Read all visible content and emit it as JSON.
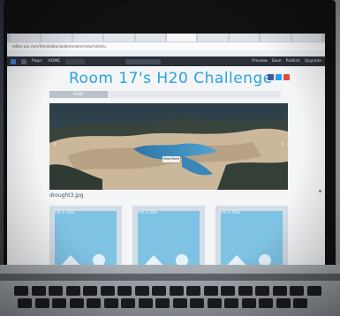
{
  "browser": {
    "tabs": [
      "",
      "",
      "",
      "",
      "",
      "",
      "",
      "",
      "",
      ""
    ],
    "url": "editor.wix.com/html/editor/web/renderer/new?siteId=",
    "bookmarks": ""
  },
  "editor": {
    "page_label": "Page:",
    "page_value": "HOME",
    "actions": [
      "Preview",
      "Save",
      "Publish",
      "Upgrade"
    ]
  },
  "site": {
    "title": "Room 17's H20 Challenge",
    "nav": [
      "HOME",
      "",
      "",
      ""
    ],
    "caption": "drought3.jpg",
    "cards": [
      {
        "label": "I'm a Title"
      },
      {
        "label": "I'm a Title"
      },
      {
        "label": "I'm a Title"
      }
    ],
    "slide_button": "View More"
  },
  "colors": {
    "title_blue": "#29a3dc",
    "card_blue": "#7fc3e4",
    "facebook": "#3b5998",
    "twitter": "#1da1f2",
    "gplus": "#dd4b39"
  }
}
